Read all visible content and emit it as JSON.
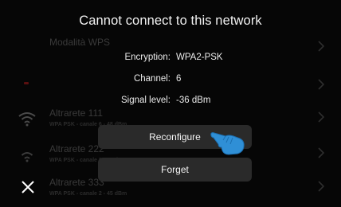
{
  "dialog": {
    "title": "Cannot connect to this network",
    "info": [
      {
        "label": "Encryption:",
        "value": "WPA2-PSK"
      },
      {
        "label": "Channel:",
        "value": "6"
      },
      {
        "label": "Signal level:",
        "value": "-36 dBm"
      }
    ],
    "reconfigure_label": "Reconfigure",
    "forget_label": "Forget"
  },
  "background_list": {
    "items": [
      {
        "name": "Modalità WPS",
        "sub": ""
      },
      {
        "name": "",
        "sub": ""
      },
      {
        "name": "Altrarete 111",
        "sub": "WPA PSK - canale 6 - 48 dBm"
      },
      {
        "name": "Altrarete 222",
        "sub": "WPA PSK - canale 2 - 45 dBm"
      },
      {
        "name": "Altrarete 333",
        "sub": "WPA PSK - canale 2 - 45 dBm"
      }
    ]
  },
  "icons": {
    "close": "close-icon",
    "wifi": "wifi-icon",
    "chevron": "chevron-right-icon",
    "hand": "pointing-hand-icon"
  },
  "colors": {
    "background": "#060606",
    "button": "#2a2a2a",
    "hand": "#2f8fd6",
    "dim_text": "#3a3a3a"
  }
}
